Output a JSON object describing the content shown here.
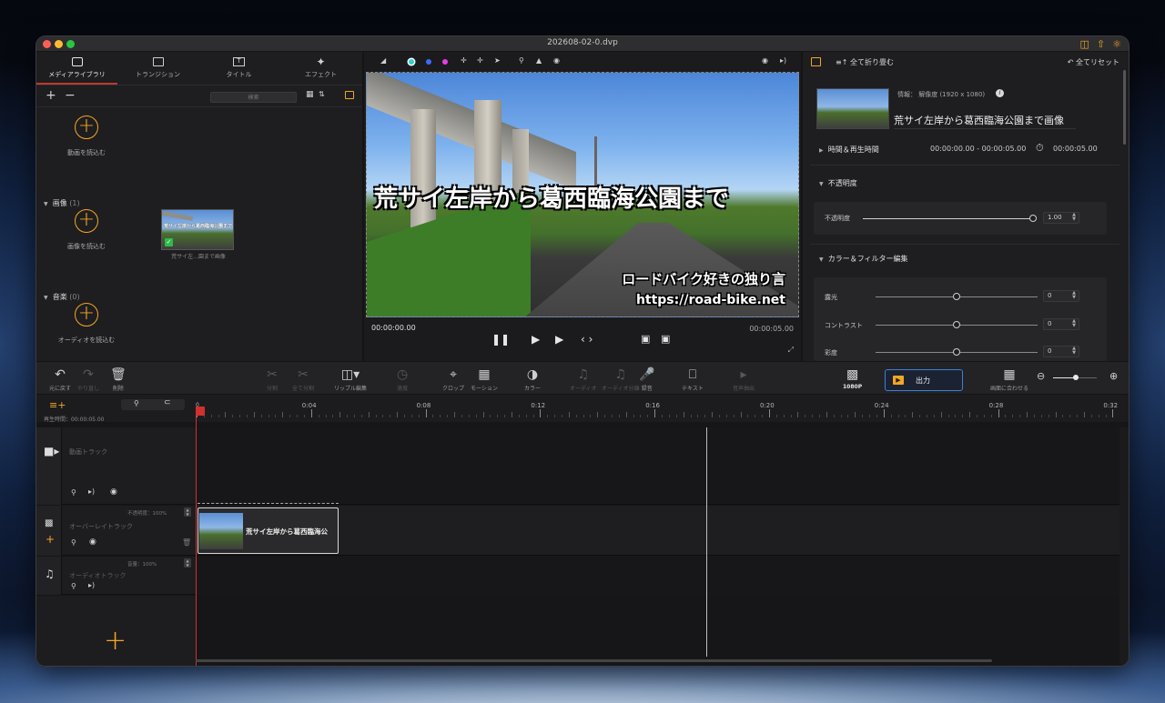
{
  "window": {
    "title": "202608-02-0.dvp"
  },
  "colors": {
    "accent": "#f5a623",
    "blue": "#3d7fd6",
    "panel": "#1e1e20",
    "bg": "#161618"
  },
  "tabs": [
    {
      "label": "メディアライブラリ",
      "icon": "media-icon"
    },
    {
      "label": "トランジション",
      "icon": "transition-icon"
    },
    {
      "label": "タイトル",
      "icon": "title-icon"
    },
    {
      "label": "エフェクト",
      "icon": "effect-icon"
    }
  ],
  "library": {
    "search_placeholder": "検索",
    "import_video": "動画を読込む",
    "image_section": {
      "title": "画像",
      "count": "(1)"
    },
    "import_image": "画像を読込む",
    "image_item": {
      "caption": "荒サイ左...園まで画像",
      "thumb_text": "荒サイ左岸から葛西臨海公園まで"
    },
    "music_section": {
      "title": "音楽",
      "count": "(0)"
    },
    "import_audio": "オーディオを読込む"
  },
  "preview": {
    "title_overlay": "荒サイ左岸から葛西臨海公園まで",
    "subtitle": "ロードバイク好きの独り言",
    "url": "https://road-bike.net",
    "time_current": "00:00:00.00",
    "time_total": "00:00:05.00"
  },
  "inspector": {
    "collapse_all": "全て折り畳む",
    "reset_all": "全てリセット",
    "info": "情報： 解像度 (1920 x 1080)",
    "clip_name": "荒サイ左岸から葛西臨海公園まで画像",
    "time_label": "時間＆再生時間",
    "time_range": "00:00:00.00 - 00:00:05.00",
    "duration": "00:00:05.00",
    "opacity_section": "不透明度",
    "opacity_label": "不透明度",
    "opacity_value": "1.00",
    "color_section": "カラー＆フィルター編集",
    "exposure": {
      "label": "露光",
      "value": "0"
    },
    "contrast": {
      "label": "コントラスト",
      "value": "0"
    },
    "saturation": {
      "label": "彩度",
      "value": "0"
    }
  },
  "toolbar": {
    "undo": "元に戻す",
    "redo": "やり直し",
    "delete": "削除",
    "split": "分割",
    "split_all": "全て分割",
    "ripple": "リップル編集",
    "speed": "速度",
    "crop": "クロップ",
    "motion": "モーション",
    "color": "カラー",
    "audio": "オーディオ",
    "audio_split": "オーディオ分離",
    "record": "録音",
    "text": "テキスト",
    "mute": "音声抽出",
    "resolution": "1080P",
    "export": "出力",
    "fit": "画面に合わせる"
  },
  "timeline": {
    "playtime_label": "再生時間：00:00:05.00",
    "ruler_start": "0",
    "ruler": [
      "0:04",
      "0:08",
      "0:12",
      "0:16",
      "0:20",
      "0:24",
      "0:28",
      "0:32"
    ],
    "video_track": "動画トラック",
    "overlay_track": "オーバーレイトラック",
    "overlay_opacity": "不透明度：100%",
    "audio_track": "オーディオトラック",
    "audio_volume": "音量：100%",
    "clip_title": "荒サイ左岸から葛西臨海公"
  }
}
